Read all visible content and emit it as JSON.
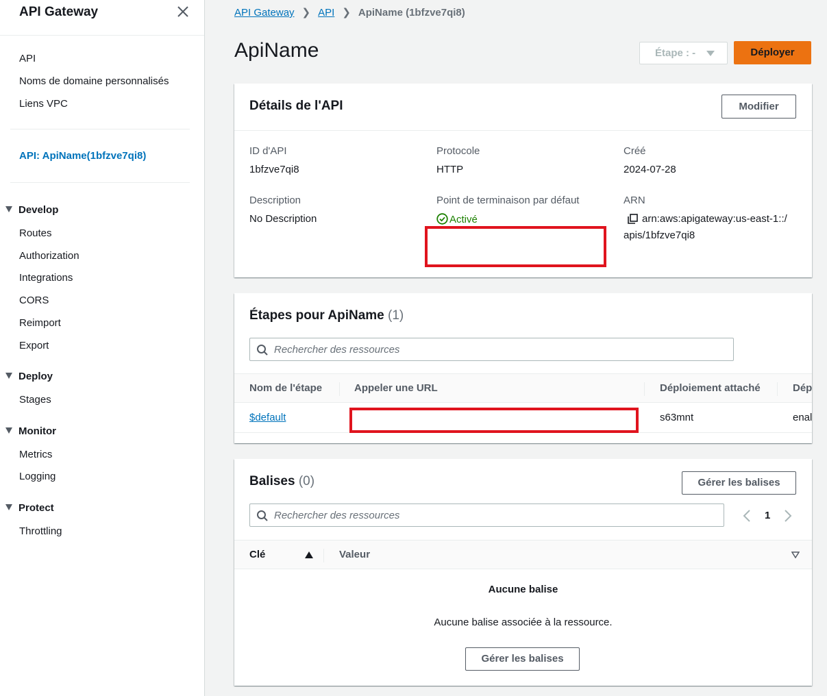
{
  "sidebar": {
    "title": "API Gateway",
    "top_links": [
      "API",
      "Noms de domaine personnalisés",
      "Liens VPC"
    ],
    "api_link": "API: ApiName(1bfzve7qi8)",
    "sections": [
      {
        "label": "Develop",
        "items": [
          "Routes",
          "Authorization",
          "Integrations",
          "CORS",
          "Reimport",
          "Export"
        ]
      },
      {
        "label": "Deploy",
        "items": [
          "Stages"
        ]
      },
      {
        "label": "Monitor",
        "items": [
          "Metrics",
          "Logging"
        ]
      },
      {
        "label": "Protect",
        "items": [
          "Throttling"
        ]
      }
    ]
  },
  "breadcrumb": {
    "items": [
      "API Gateway",
      "API"
    ],
    "current": "ApiName (1bfzve7qi8)"
  },
  "header": {
    "title": "ApiName",
    "stage_select": "Étape : -",
    "deploy_label": "Déployer"
  },
  "details": {
    "title": "Détails de l'API",
    "edit_label": "Modifier",
    "id_label": "ID d'API",
    "id_value": "1bfzve7qi8",
    "protocol_label": "Protocole",
    "protocol_value": "HTTP",
    "created_label": "Créé",
    "created_value": "2024-07-28",
    "description_label": "Description",
    "description_value": "No Description",
    "endpoint_label": "Point de terminaison par défaut",
    "endpoint_value": "Activé",
    "arn_label": "ARN",
    "arn_line1": "arn:aws:apigateway:us-east-1::/",
    "arn_line2": "apis/1bfzve7qi8"
  },
  "stages": {
    "title": "Étapes pour ApiName",
    "count": "(1)",
    "search_placeholder": "Rechercher des ressources",
    "columns": [
      "Nom de l'étape",
      "Appeler une URL",
      "Déploiement attaché",
      "Dép"
    ],
    "rows": [
      {
        "name": "$default",
        "deployment": "s63mnt",
        "extra": "enal"
      }
    ]
  },
  "tags": {
    "title": "Balises",
    "count": "(0)",
    "manage_label": "Gérer les balises",
    "search_placeholder": "Rechercher des ressources",
    "page": "1",
    "columns": [
      "Clé",
      "Valeur"
    ],
    "empty_title": "Aucune balise",
    "empty_desc": "Aucune balise associée à la ressource.",
    "empty_button": "Gérer les balises"
  },
  "colors": {
    "accent": "#ec7211",
    "link": "#0073bb",
    "success": "#1d8102",
    "redaction": "#e0141e"
  }
}
